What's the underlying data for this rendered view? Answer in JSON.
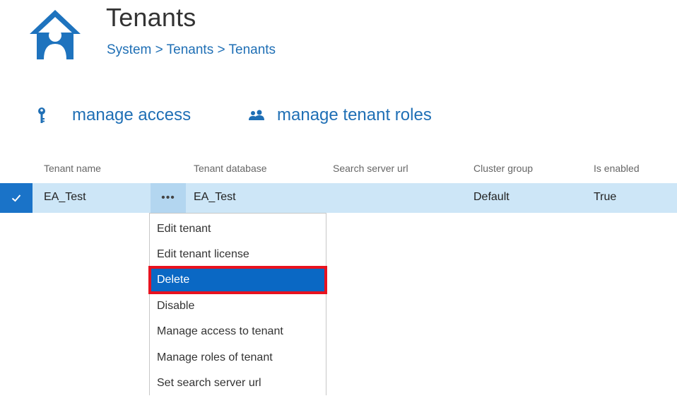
{
  "header": {
    "title": "Tenants",
    "breadcrumb": "System > Tenants > Tenants",
    "icon": "house-person-icon"
  },
  "actions": [
    {
      "label": "manage access",
      "icon": "key-icon"
    },
    {
      "label": "manage tenant roles",
      "icon": "users-icon"
    }
  ],
  "table": {
    "columns": [
      "Tenant name",
      "Tenant database",
      "Search server url",
      "Cluster group",
      "Is enabled"
    ],
    "rows": [
      {
        "tenant_name": "EA_Test",
        "tenant_database": "EA_Test",
        "search_server_url": "",
        "cluster_group": "Default",
        "is_enabled": "True",
        "selected": true
      }
    ],
    "row_menu_button": "•••"
  },
  "context_menu": {
    "items": [
      {
        "label": "Edit tenant"
      },
      {
        "label": "Edit tenant license"
      },
      {
        "label": "Delete",
        "highlighted": true
      },
      {
        "label": "Disable"
      },
      {
        "label": "Manage access to tenant"
      },
      {
        "label": "Manage roles of tenant"
      },
      {
        "label": "Set search server url"
      }
    ]
  },
  "colors": {
    "accent": "#1f6fb5",
    "selected_row_bg": "#cde6f7",
    "check_bg": "#1a73c8",
    "menu_highlight": "#0a68c4",
    "highlight_outline": "#e8121f"
  }
}
